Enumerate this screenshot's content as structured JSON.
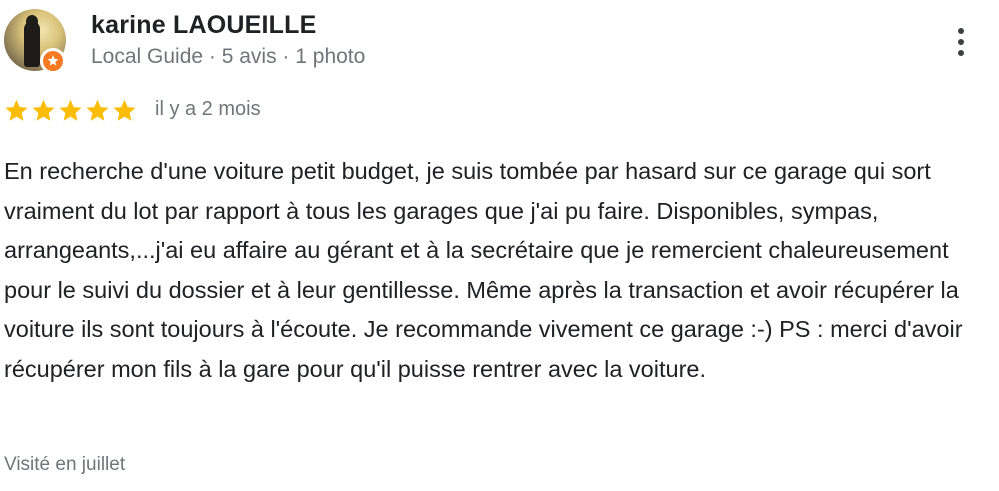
{
  "reviewer": {
    "name": "karine LAOUEILLE",
    "meta": "Local Guide · 5 avis · 1 photo"
  },
  "rating": {
    "stars": 5,
    "max": 5,
    "star_color": "#fbbc04"
  },
  "time_ago": "il y a 2 mois",
  "review_text": "En recherche d'une voiture petit budget, je suis tombée par hasard sur ce garage qui sort vraiment du lot par rapport à tous les garages que j'ai pu faire. Disponibles, sympas, arrangeants,...j'ai eu affaire au gérant et à la secrétaire que je remercient chaleureusement pour le suivi du dossier et à leur gentillesse. Même après la transaction et avoir récupérer la voiture ils sont toujours à l'écoute. Je recommande vivement ce garage :-) PS : merci d'avoir récupérer mon fils à la gare pour qu'il puisse rentrer avec la voiture.",
  "visited": "Visité en juillet",
  "icons": {
    "avatar": "profile-photo",
    "badge": "local-guide-badge-icon",
    "menu": "more-vert-icon",
    "star": "star-icon"
  },
  "colors": {
    "guide_badge": "#f57a22",
    "secondary_text": "#70757a"
  }
}
